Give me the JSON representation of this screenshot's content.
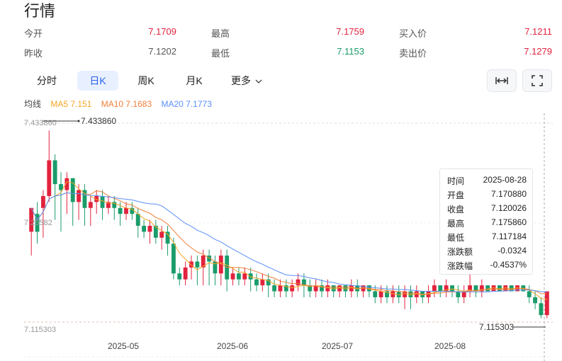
{
  "page_title": "行情",
  "quote": {
    "open_label": "今开",
    "open_value": "7.1709",
    "high_label": "最高",
    "high_value": "7.1759",
    "bid_label": "买入价",
    "bid_value": "7.1211",
    "prev_close_label": "昨收",
    "prev_close_value": "7.1202",
    "low_label": "最低",
    "low_value": "7.1153",
    "ask_label": "卖出价",
    "ask_value": "7.1279"
  },
  "tabs": [
    "分时",
    "日K",
    "周K",
    "月K",
    "更多"
  ],
  "active_tab": "日K",
  "ma_legend": {
    "label": "均线",
    "ma5": "MA5 7.151",
    "ma10": "MA10 7.1683",
    "ma20": "MA20 7.1773"
  },
  "colors": {
    "up": "#e2233e",
    "down": "#1a9c6a",
    "ma5": "#f5a623",
    "ma10": "#f07f3a",
    "ma20": "#5b8ff9",
    "active": "#2a62e8"
  },
  "icons": [
    "expand-horizontal-icon",
    "fullscreen-icon",
    "chevron-down-icon"
  ],
  "tooltip": {
    "rows": [
      {
        "k": "时间",
        "v": "2025-08-28",
        "cls": ""
      },
      {
        "k": "开盘",
        "v": "7.170880",
        "cls": ""
      },
      {
        "k": "收盘",
        "v": "7.120026",
        "cls": ""
      },
      {
        "k": "最高",
        "v": "7.175860",
        "cls": ""
      },
      {
        "k": "最低",
        "v": "7.117184",
        "cls": ""
      },
      {
        "k": "涨跌额",
        "v": "-0.0324",
        "cls": "down"
      },
      {
        "k": "涨跌幅",
        "v": "-0.4537%",
        "cls": "down"
      }
    ]
  },
  "chart_data": {
    "type": "candlestick",
    "y_max_label": "7.433860",
    "y_top_tick": "7.433860",
    "y_mid_tick": "7.25582",
    "y_bottom_tick": "7.115303",
    "y_min_label": "7.115303",
    "ylim": [
      7.1,
      7.44
    ],
    "x_ticks": [
      "2025-05",
      "2025-06",
      "2025-07",
      "2025-08"
    ],
    "grid": "horizontal-dashed",
    "candles": [
      [
        7.26,
        7.3,
        7.22,
        7.28
      ],
      [
        7.29,
        7.26,
        7.24,
        7.31
      ],
      [
        7.3,
        7.32,
        7.25,
        7.33
      ],
      [
        7.32,
        7.38,
        7.31,
        7.43
      ],
      [
        7.38,
        7.34,
        7.28,
        7.39
      ],
      [
        7.34,
        7.33,
        7.26,
        7.36
      ],
      [
        7.33,
        7.35,
        7.29,
        7.36
      ],
      [
        7.35,
        7.31,
        7.27,
        7.35
      ],
      [
        7.31,
        7.33,
        7.28,
        7.34
      ],
      [
        7.33,
        7.3,
        7.27,
        7.34
      ],
      [
        7.3,
        7.31,
        7.27,
        7.32
      ],
      [
        7.31,
        7.32,
        7.29,
        7.33
      ],
      [
        7.32,
        7.3,
        7.28,
        7.33
      ],
      [
        7.3,
        7.31,
        7.29,
        7.32
      ],
      [
        7.31,
        7.3,
        7.28,
        7.32
      ],
      [
        7.3,
        7.29,
        7.27,
        7.31
      ],
      [
        7.29,
        7.3,
        7.28,
        7.31
      ],
      [
        7.3,
        7.29,
        7.28,
        7.31
      ],
      [
        7.29,
        7.27,
        7.25,
        7.3
      ],
      [
        7.27,
        7.26,
        7.25,
        7.28
      ],
      [
        7.26,
        7.27,
        7.24,
        7.28
      ],
      [
        7.27,
        7.25,
        7.24,
        7.28
      ],
      [
        7.25,
        7.26,
        7.23,
        7.27
      ],
      [
        7.26,
        7.24,
        7.22,
        7.27
      ],
      [
        7.24,
        7.19,
        7.18,
        7.25
      ],
      [
        7.19,
        7.18,
        7.17,
        7.2
      ],
      [
        7.18,
        7.2,
        7.17,
        7.21
      ],
      [
        7.2,
        7.21,
        7.18,
        7.22
      ],
      [
        7.21,
        7.2,
        7.17,
        7.22
      ],
      [
        7.2,
        7.22,
        7.17,
        7.23
      ],
      [
        7.22,
        7.21,
        7.17,
        7.23
      ],
      [
        7.21,
        7.19,
        7.17,
        7.22
      ],
      [
        7.19,
        7.22,
        7.17,
        7.23
      ],
      [
        7.22,
        7.18,
        7.16,
        7.23
      ],
      [
        7.18,
        7.19,
        7.17,
        7.2
      ],
      [
        7.19,
        7.18,
        7.17,
        7.2
      ],
      [
        7.18,
        7.19,
        7.17,
        7.2
      ],
      [
        7.19,
        7.18,
        7.16,
        7.2
      ],
      [
        7.18,
        7.17,
        7.16,
        7.19
      ],
      [
        7.17,
        7.18,
        7.16,
        7.19
      ],
      [
        7.18,
        7.17,
        7.15,
        7.19
      ],
      [
        7.17,
        7.16,
        7.15,
        7.18
      ],
      [
        7.16,
        7.17,
        7.15,
        7.18
      ],
      [
        7.17,
        7.16,
        7.15,
        7.18
      ],
      [
        7.16,
        7.17,
        7.15,
        7.18
      ],
      [
        7.17,
        7.18,
        7.16,
        7.19
      ],
      [
        7.18,
        7.17,
        7.15,
        7.19
      ],
      [
        7.17,
        7.16,
        7.15,
        7.18
      ],
      [
        7.16,
        7.17,
        7.15,
        7.18
      ],
      [
        7.17,
        7.16,
        7.15,
        7.18
      ],
      [
        7.16,
        7.17,
        7.15,
        7.18
      ],
      [
        7.17,
        7.16,
        7.15,
        7.17
      ],
      [
        7.16,
        7.17,
        7.15,
        7.17
      ],
      [
        7.17,
        7.16,
        7.15,
        7.17
      ],
      [
        7.16,
        7.17,
        7.15,
        7.18
      ],
      [
        7.17,
        7.16,
        7.15,
        7.18
      ],
      [
        7.16,
        7.17,
        7.15,
        7.17
      ],
      [
        7.17,
        7.16,
        7.15,
        7.17
      ],
      [
        7.16,
        7.15,
        7.14,
        7.17
      ],
      [
        7.15,
        7.16,
        7.14,
        7.17
      ],
      [
        7.16,
        7.15,
        7.14,
        7.17
      ],
      [
        7.15,
        7.16,
        7.14,
        7.17
      ],
      [
        7.16,
        7.15,
        7.14,
        7.17
      ],
      [
        7.15,
        7.16,
        7.13,
        7.17
      ],
      [
        7.16,
        7.15,
        7.13,
        7.17
      ],
      [
        7.15,
        7.16,
        7.14,
        7.17
      ],
      [
        7.16,
        7.15,
        7.14,
        7.16
      ],
      [
        7.15,
        7.16,
        7.14,
        7.17
      ],
      [
        7.16,
        7.17,
        7.15,
        7.18
      ],
      [
        7.17,
        7.16,
        7.15,
        7.17
      ],
      [
        7.16,
        7.17,
        7.15,
        7.18
      ],
      [
        7.17,
        7.16,
        7.15,
        7.17
      ],
      [
        7.16,
        7.15,
        7.14,
        7.17
      ],
      [
        7.15,
        7.16,
        7.14,
        7.17
      ],
      [
        7.16,
        7.17,
        7.15,
        7.2
      ],
      [
        7.17,
        7.16,
        7.15,
        7.17
      ],
      [
        7.16,
        7.17,
        7.15,
        7.18
      ],
      [
        7.17,
        7.16,
        7.16,
        7.17
      ],
      [
        7.16,
        7.17,
        7.16,
        7.17
      ],
      [
        7.17,
        7.16,
        7.16,
        7.17
      ],
      [
        7.16,
        7.17,
        7.16,
        7.17
      ],
      [
        7.17,
        7.16,
        7.16,
        7.17
      ],
      [
        7.16,
        7.17,
        7.16,
        7.17
      ],
      [
        7.17,
        7.16,
        7.16,
        7.17
      ],
      [
        7.16,
        7.15,
        7.14,
        7.17
      ],
      [
        7.15,
        7.14,
        7.13,
        7.16
      ],
      [
        7.14,
        7.12,
        7.115,
        7.15
      ],
      [
        7.12,
        7.16,
        7.115,
        7.16
      ]
    ]
  }
}
